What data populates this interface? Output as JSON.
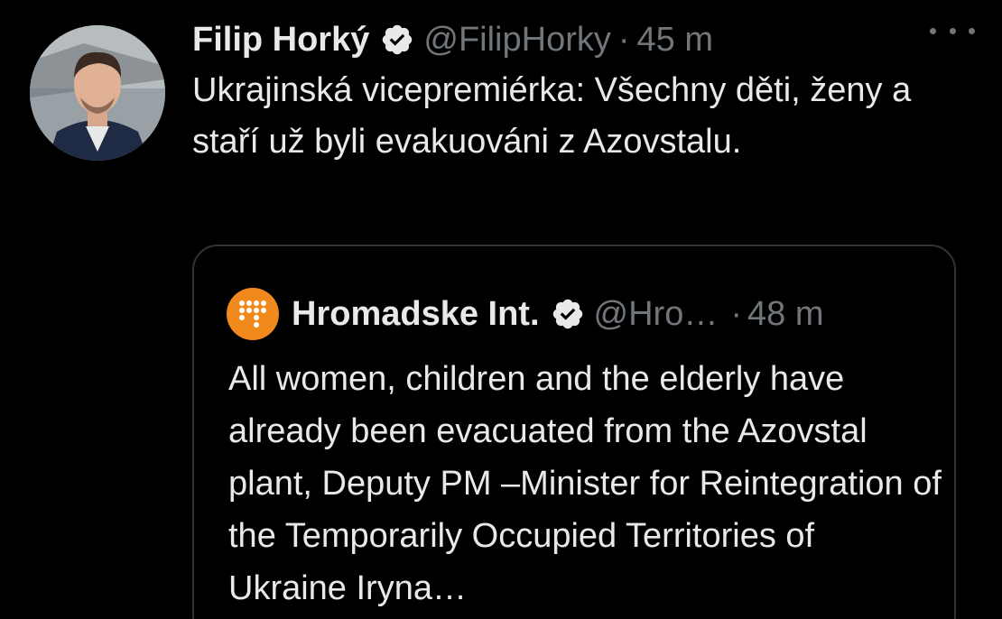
{
  "tweet": {
    "author_name": "Filip Horký",
    "author_handle": "@FilipHorky",
    "separator": "·",
    "time": "45 m",
    "text": "Ukrajinská vicepremiérka: Všechny děti, ženy a staří už byli evakuováni z Azovstalu."
  },
  "quoted_tweet": {
    "author_name": "Hromadske Int.",
    "author_handle": "@Hro…",
    "separator": "·",
    "time": "48 m",
    "text": "All women, children and the elderly have already been evacuated from the Azovstal plant, Deputy PM –Minister for Reintegration of the Temporarily Occupied Territories of Ukraine Iryna…"
  },
  "icons": {
    "verified": "verified-badge-icon",
    "more": "more-options-icon"
  },
  "colors": {
    "background": "#000000",
    "primary_text": "#e7e9ea",
    "secondary_text": "#71767b",
    "border": "#2f3336",
    "quote_avatar": "#f08a1c"
  }
}
